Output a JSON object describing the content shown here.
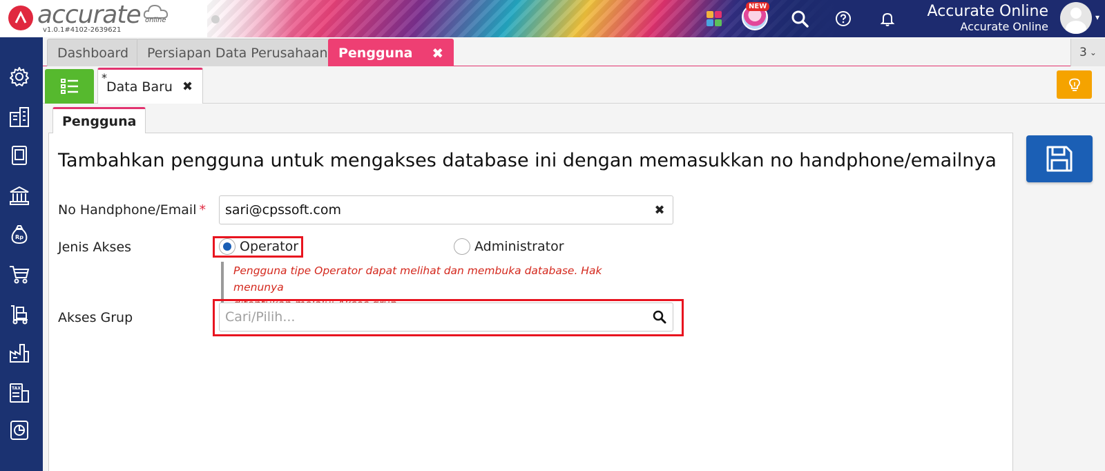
{
  "app": {
    "logo_text": "accurate",
    "logo_sub": "online",
    "version": "v1.0.1#4102-2639621",
    "new_badge": "NEW",
    "user_name": "Accurate Online",
    "user_company": "Accurate Online"
  },
  "tabs": {
    "items": [
      {
        "label": "Dashboard"
      },
      {
        "label": "Persiapan Data Perusahaan"
      },
      {
        "label": "Pengguna"
      }
    ],
    "close_glyph": "✖",
    "count": "3"
  },
  "subtabs": {
    "doc_marker": "*",
    "doc_label": "Data Baru",
    "close_glyph": "✖"
  },
  "form": {
    "section_tab": "Pengguna",
    "title": "Tambahkan pengguna untuk mengakses database ini dengan memasukkan no handphone/emailnya",
    "contact_label": "No Handphone/Email",
    "required_mark": "*",
    "contact_value": "sari@cpssoft.com",
    "access_label": "Jenis Akses",
    "access_options": [
      {
        "label": "Operator",
        "checked": true
      },
      {
        "label": "Administrator",
        "checked": false
      }
    ],
    "hint_line1": "Pengguna tipe Operator dapat melihat dan membuka database. Hak menunya",
    "hint_line2": "ditentukan melalui Akses grup.",
    "group_label": "Akses Grup",
    "group_placeholder": "Cari/Pilih..."
  },
  "colors": {
    "sidebar": "#1b3271",
    "accent_pink": "#ee3f73",
    "save_blue": "#1b5fb5",
    "list_green": "#56b92e",
    "tip_orange": "#f5a300",
    "highlight_red": "#e8141f",
    "hint_red": "#d4281d"
  },
  "icons": {
    "sidebar": [
      "gear-icon",
      "building-icon",
      "book-icon",
      "bank-icon",
      "money-bag-icon",
      "cart-icon",
      "hand-truck-icon",
      "factory-icon",
      "tax-icon",
      "report-icon"
    ],
    "top": [
      "apps-icon",
      "search-icon",
      "help-icon",
      "bell-icon",
      "user-avatar-icon"
    ]
  }
}
